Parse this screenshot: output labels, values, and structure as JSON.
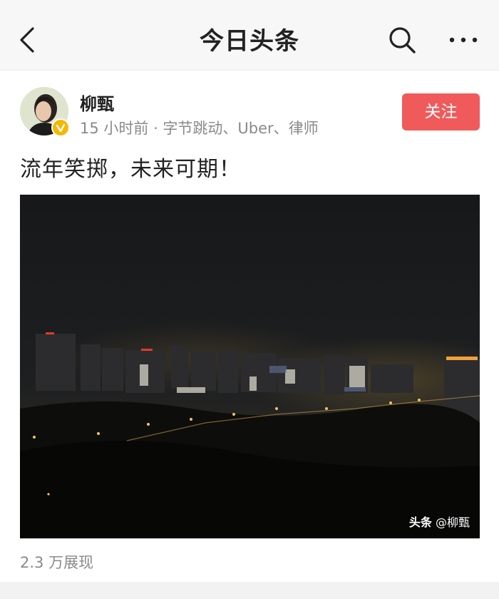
{
  "header": {
    "title": "今日头条",
    "icons": {
      "back": "chevron-left-icon",
      "search": "search-icon",
      "more": "more-dots-icon"
    }
  },
  "author": {
    "name": "柳甄",
    "meta": "15 小时前 · 字节跳动、Uber、律师",
    "verified_badge": "verified-v-icon",
    "follow_label": "关注"
  },
  "post": {
    "text": "流年笑掷，未来可期！",
    "watermark_brand": "头条",
    "watermark_handle": "@柳甄",
    "views": "2.3 万展现"
  },
  "colors": {
    "follow_button": "#f15a5a",
    "badge": "#f5b700",
    "secondary_text": "#8a8a8a"
  }
}
